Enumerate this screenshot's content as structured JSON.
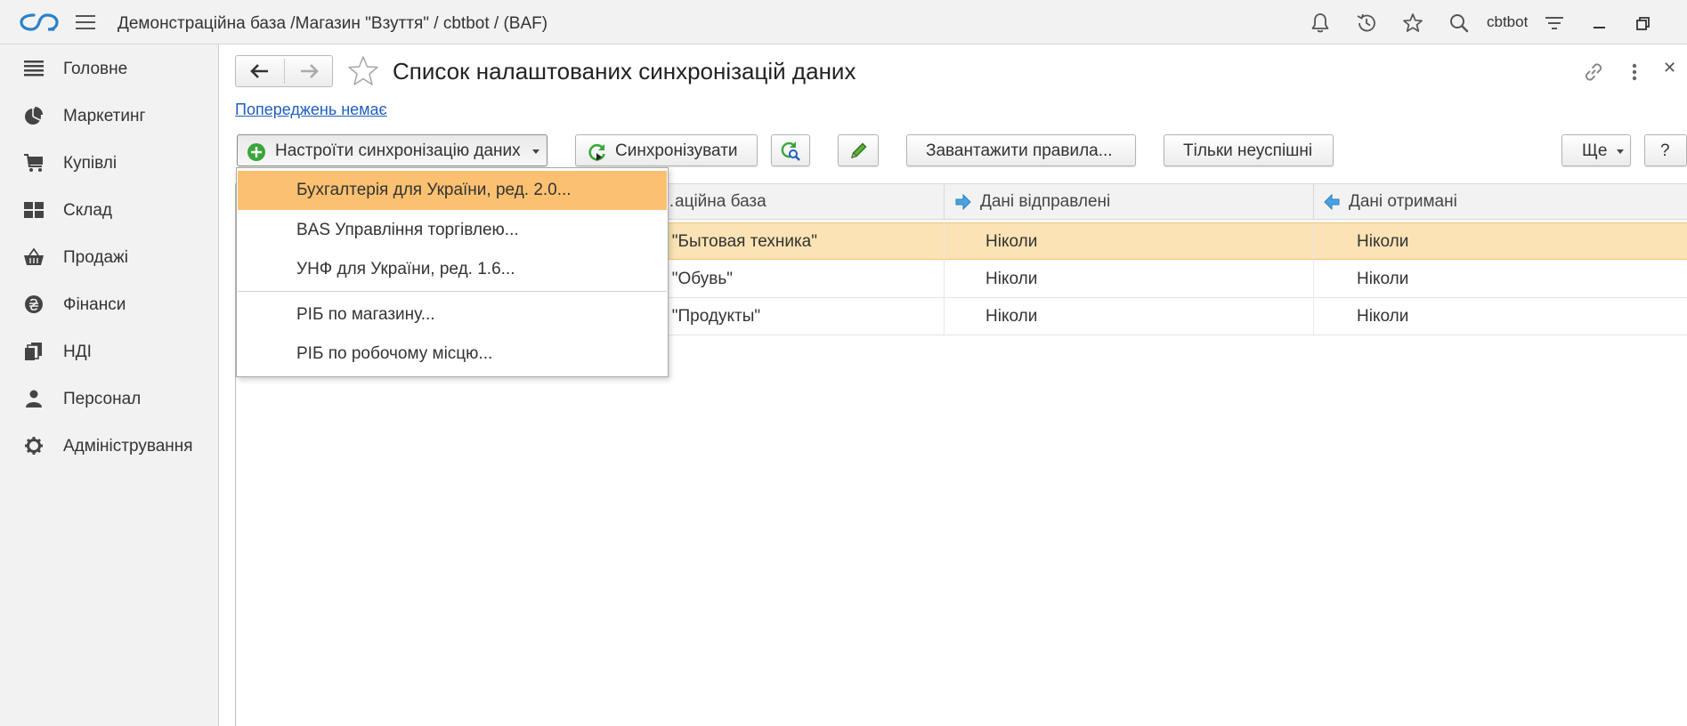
{
  "topbar": {
    "title": "Демонстраційна база /Магазин \"Взуття\" / cbtbot /  (BAF)",
    "user": "cbtbot",
    "icons": [
      "logo-icon",
      "menu-icon",
      "bell-icon",
      "history-icon",
      "star-icon",
      "search-icon",
      "filter-icon",
      "minimize-icon",
      "restore-icon"
    ]
  },
  "sidebar": {
    "items": [
      {
        "label": "Головне",
        "icon": "list-icon"
      },
      {
        "label": "Маркетинг",
        "icon": "pie-chart-icon"
      },
      {
        "label": "Купівлі",
        "icon": "cart-icon"
      },
      {
        "label": "Склад",
        "icon": "warehouse-icon"
      },
      {
        "label": "Продажі",
        "icon": "basket-icon"
      },
      {
        "label": "Фінанси",
        "icon": "hryvnia-icon"
      },
      {
        "label": "НДІ",
        "icon": "documents-icon"
      },
      {
        "label": "Персонал",
        "icon": "person-icon"
      },
      {
        "label": "Адміністрування",
        "icon": "gear-icon"
      }
    ]
  },
  "page": {
    "title": "Список налаштованих синхронізацій даних",
    "warnings_link": "Попереджень немає"
  },
  "toolbar": {
    "setup_sync": "Настроїти синхронізацію даних",
    "synchronize": "Синхронізувати",
    "load_rules": "Завантажити правила...",
    "only_failed": "Тільки неуспішні",
    "more": "Ще",
    "help": "?"
  },
  "table": {
    "columns": [
      "…аційна база",
      "Дані відправлені",
      "Дані отримані"
    ],
    "rows": [
      {
        "base": "н \"Бытовая техника\"",
        "sent": "Ніколи",
        "received": "Ніколи",
        "selected": true
      },
      {
        "base": "н \"Обувь\"",
        "sent": "Ніколи",
        "received": "Ніколи",
        "selected": false
      },
      {
        "base": "н \"Продукты\"",
        "sent": "Ніколи",
        "received": "Ніколи",
        "selected": false
      }
    ]
  },
  "dropdown": {
    "items": [
      "Бухгалтерія для України, ред. 2.0...",
      "BAS Управління торгівлею...",
      "УНФ для України, ред. 1.6...",
      "РІБ по магазину...",
      "РІБ по робочому місцю..."
    ]
  },
  "colors": {
    "highlight": "#fbc171",
    "selected_row": "#fbe3b5",
    "link": "#1f5fbf",
    "accent_green": "#3aa63a",
    "logo_blue": "#2a82c9"
  }
}
